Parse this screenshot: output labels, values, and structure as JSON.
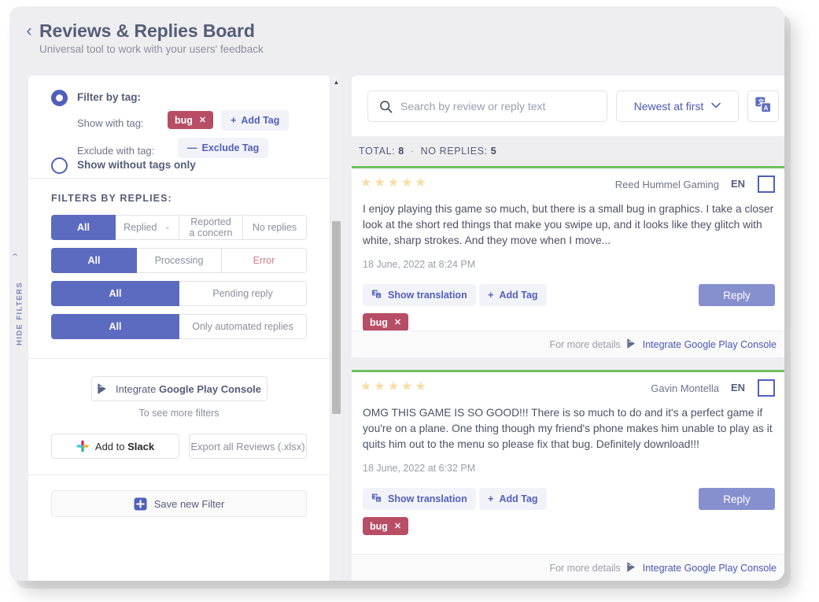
{
  "header": {
    "back_icon": "chevron-left-icon",
    "title": "Reviews & Replies Board",
    "subtitle": "Universal tool to work with your users' feedback"
  },
  "rail": {
    "chevron": "‹",
    "label": "HIDE FILTERS"
  },
  "sidebar": {
    "tag_filter": {
      "radio_filter_by_tag_label": "Filter by tag:",
      "radio_filter_by_tag_selected": true,
      "show_with_tag_label": "Show with tag:",
      "show_with_tag_value": "bug",
      "show_with_tag_remove": "✕",
      "add_tag_label": "Add Tag",
      "add_tag_plus": "+",
      "exclude_with_tag_label": "Exclude with tag:",
      "exclude_tag_label": "Exclude Tag",
      "exclude_tag_minus": "—",
      "radio_without_tags_label": "Show without tags only",
      "radio_without_tags_selected": false
    },
    "replies_filters": {
      "title": "FILTERS BY REPLIES:",
      "groups": [
        {
          "options": [
            {
              "label": "All",
              "active": true
            },
            {
              "label": "Replied",
              "active": false,
              "chevron": "⌄"
            },
            {
              "label": "Reported\na concern",
              "active": false
            },
            {
              "label": "No replies",
              "active": false
            }
          ]
        },
        {
          "options": [
            {
              "label": "All",
              "active": true
            },
            {
              "label": "Processing",
              "active": false
            },
            {
              "label": "Error",
              "active": false,
              "style": "error"
            }
          ]
        },
        {
          "options": [
            {
              "label": "All",
              "active": true
            },
            {
              "label": "Pending reply",
              "active": false
            }
          ]
        },
        {
          "options": [
            {
              "label": "All",
              "active": true
            },
            {
              "label": "Only automated replies",
              "active": false
            }
          ]
        }
      ]
    },
    "integrations": {
      "integrate_prefix": "Integrate ",
      "integrate_bold": "Google Play Console",
      "to_see_more_filters": "To see more filters",
      "add_to_slack_prefix": "Add to ",
      "add_to_slack_bold": "Slack",
      "export_label": "Export all Reviews (.xlsx)",
      "save_filter_label": "Save new Filter"
    }
  },
  "main": {
    "search": {
      "placeholder": "Search by review or reply text",
      "value": "",
      "icon": "search-icon"
    },
    "sort": {
      "value": "Newest at first",
      "chevron": "⌄"
    },
    "translate_button_icon": "translate-icon",
    "totals": {
      "total_label": "TOTAL:",
      "total_value": "8",
      "separator": "·",
      "no_replies_label": "NO REPLIES:",
      "no_replies_value": "5"
    },
    "reviews": [
      {
        "rating": 5,
        "author": "Reed Hummel Gaming",
        "lang": "EN",
        "text": "I enjoy playing this game so much, but there is a small bug in graphics. I take a closer look at the short red things that make you swipe up, and it looks like they glitch with white, sharp strokes. And they move when I move...",
        "date": "18 June, 2022 at 8:24 PM",
        "show_translation_label": "Show translation",
        "add_tag_label": "Add Tag",
        "add_tag_plus": "+",
        "reply_label": "Reply",
        "tags": [
          {
            "label": "bug",
            "remove": "✕"
          }
        ],
        "footer_muted": "For more details",
        "footer_link": "Integrate Google Play Console"
      },
      {
        "rating": 5,
        "author": "Gavin Montella",
        "lang": "EN",
        "text": "OMG THIS GAME IS SO GOOD!!! There is so much to do and it's a perfect game if you're on a plane. One thing though my friend's phone makes him unable to play as it quits him out to the menu so please fix that bug. Definitely download!!!",
        "date": "18 June, 2022 at 6:32 PM",
        "show_translation_label": "Show translation",
        "add_tag_label": "Add Tag",
        "add_tag_plus": "+",
        "reply_label": "Reply",
        "tags": [
          {
            "label": "bug",
            "remove": "✕"
          }
        ],
        "footer_muted": "For more details",
        "footer_link": "Integrate Google Play Console"
      }
    ]
  },
  "colors": {
    "accent": "#5c6bc0",
    "tag": "#b74e66",
    "star": "#f8dda3",
    "card_top": "#6fbf5f",
    "link": "#4a57b0",
    "error": "#d47b86"
  }
}
